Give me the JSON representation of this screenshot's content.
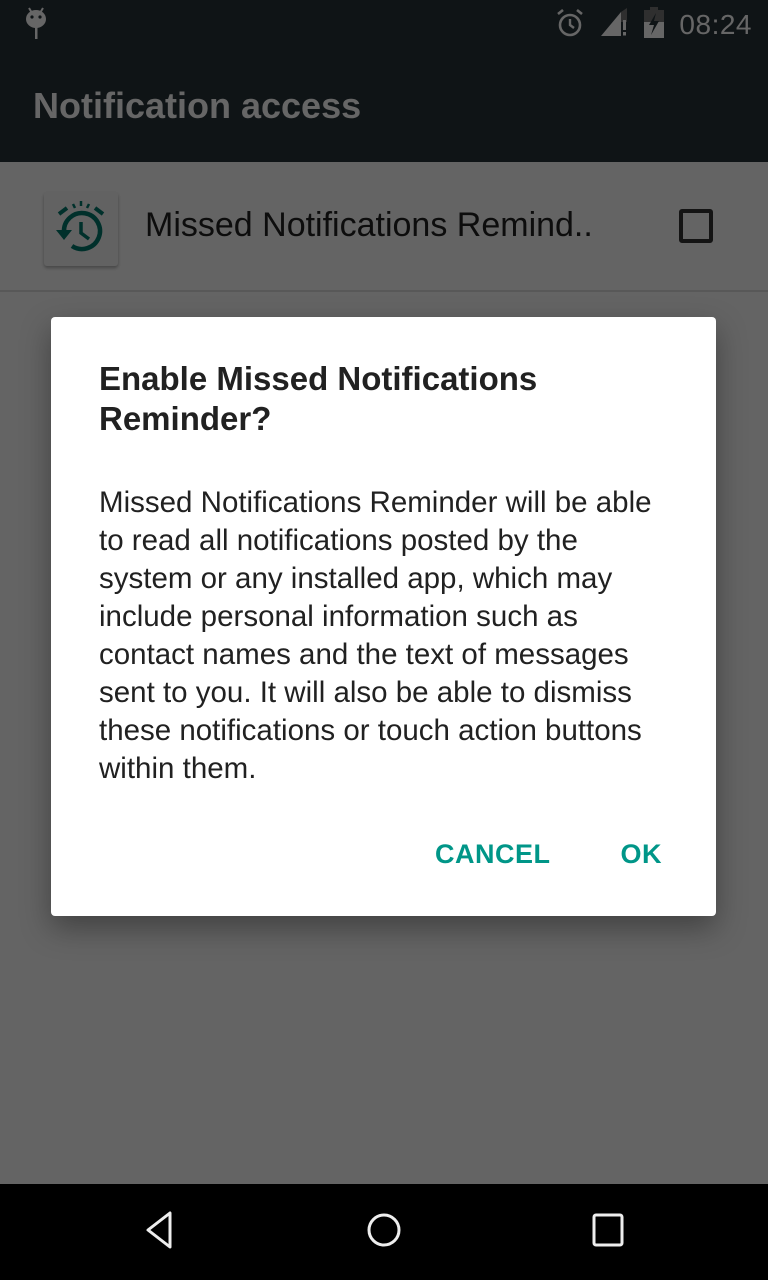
{
  "status_bar": {
    "left_icons": [
      "android-debug-icon"
    ],
    "right_icons": [
      "alarm-icon",
      "signal-no-data-icon",
      "battery-charging-icon"
    ],
    "time": "08:24"
  },
  "app_bar": {
    "title": "Notification access"
  },
  "list": {
    "items": [
      {
        "icon": "missed-notifications-reminder-icon",
        "label": "Missed Notifications Remind..",
        "checked": false
      }
    ]
  },
  "dialog": {
    "title": "Enable Missed Notifications Reminder?",
    "message": "Missed Notifications Reminder will be able to read all notifications posted by the system or any installed app, which may include personal information such as contact names and the text of messages sent to you. It will also be able to dismiss these notifications or touch action buttons within them.",
    "buttons": {
      "cancel": "CANCEL",
      "ok": "OK"
    }
  },
  "nav_bar": {
    "buttons": [
      "back",
      "home",
      "recents"
    ]
  },
  "colors": {
    "accent": "#009688",
    "app_icon_green": "#00796b",
    "status_bar": "#263238",
    "scrim": "rgba(0,0,0,0.6)"
  }
}
